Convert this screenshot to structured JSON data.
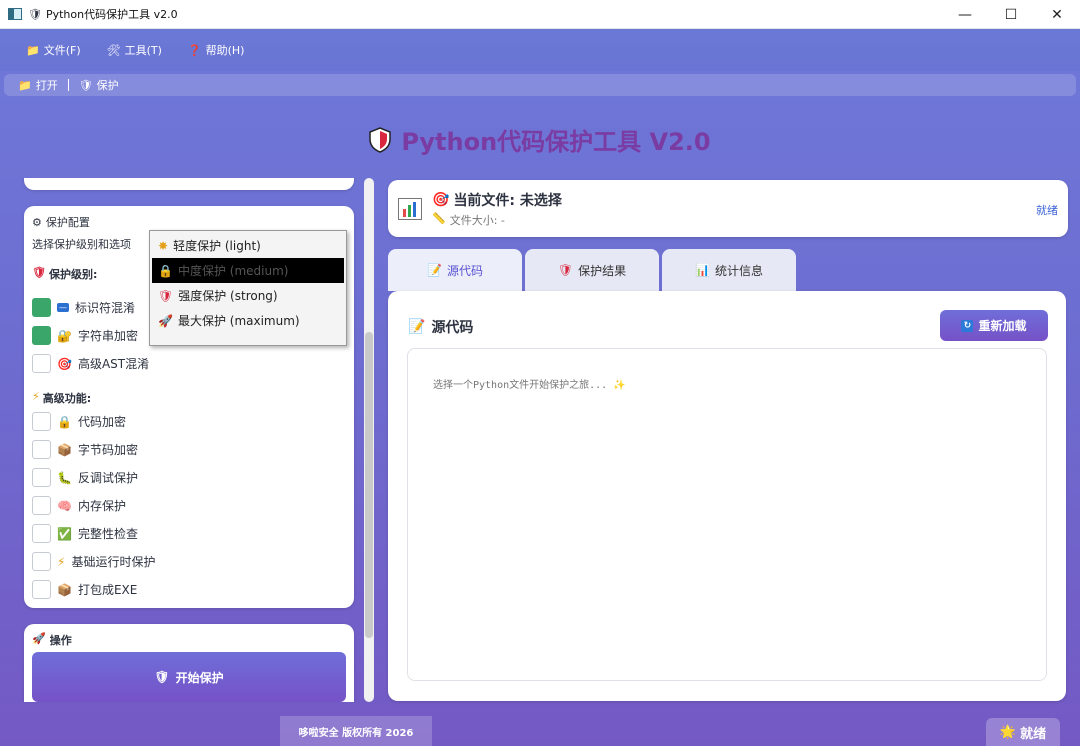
{
  "window": {
    "title": "Python代码保护工具 v2.0"
  },
  "menu": {
    "items": [
      "文件(F)",
      "工具(T)",
      "帮助(H)"
    ]
  },
  "toolbar": {
    "open": "打开",
    "protect": "保护"
  },
  "app_title": "Python代码保护工具 V2.0",
  "config": {
    "title": "保护配置",
    "subtitle": "选择保护级别和选项",
    "level_label": "保护级别:",
    "options": [
      {
        "label": "标识符混淆",
        "checked": true
      },
      {
        "label": "字符串加密",
        "checked": true
      },
      {
        "label": "高级AST混淆",
        "checked": false
      }
    ],
    "advanced_label": "高级功能:",
    "advanced": [
      {
        "label": "代码加密",
        "checked": false
      },
      {
        "label": "字节码加密",
        "checked": false
      },
      {
        "label": "反调试保护",
        "checked": false
      },
      {
        "label": "内存保护",
        "checked": false
      },
      {
        "label": "完整性检查",
        "checked": false
      },
      {
        "label": "基础运行时保护",
        "checked": false
      },
      {
        "label": "打包成EXE",
        "checked": false
      }
    ]
  },
  "dropdown": {
    "options": [
      "轻度保护 (light)",
      "中度保护 (medium)",
      "强度保护 (strong)",
      "最大保护 (maximum)"
    ],
    "selected_index": 1
  },
  "operations": {
    "title": "操作",
    "start_button": "开始保护"
  },
  "file": {
    "title": "当前文件: 未选择",
    "size": "文件大小: -",
    "status": "就绪"
  },
  "tabs": [
    "源代码",
    "保护结果",
    "统计信息"
  ],
  "source": {
    "title": "源代码",
    "reload_button": "重新加载",
    "placeholder": "选择一个Python文件开始保护之旅..."
  },
  "statusbar": {
    "copyright": "哆啦安全 版权所有 2026",
    "status": "就绪"
  },
  "colors": {
    "accent": "#6f6ed9",
    "title_purple": "#7a3ba2",
    "check_green": "#3aa66a",
    "link_blue": "#3d63d9"
  }
}
